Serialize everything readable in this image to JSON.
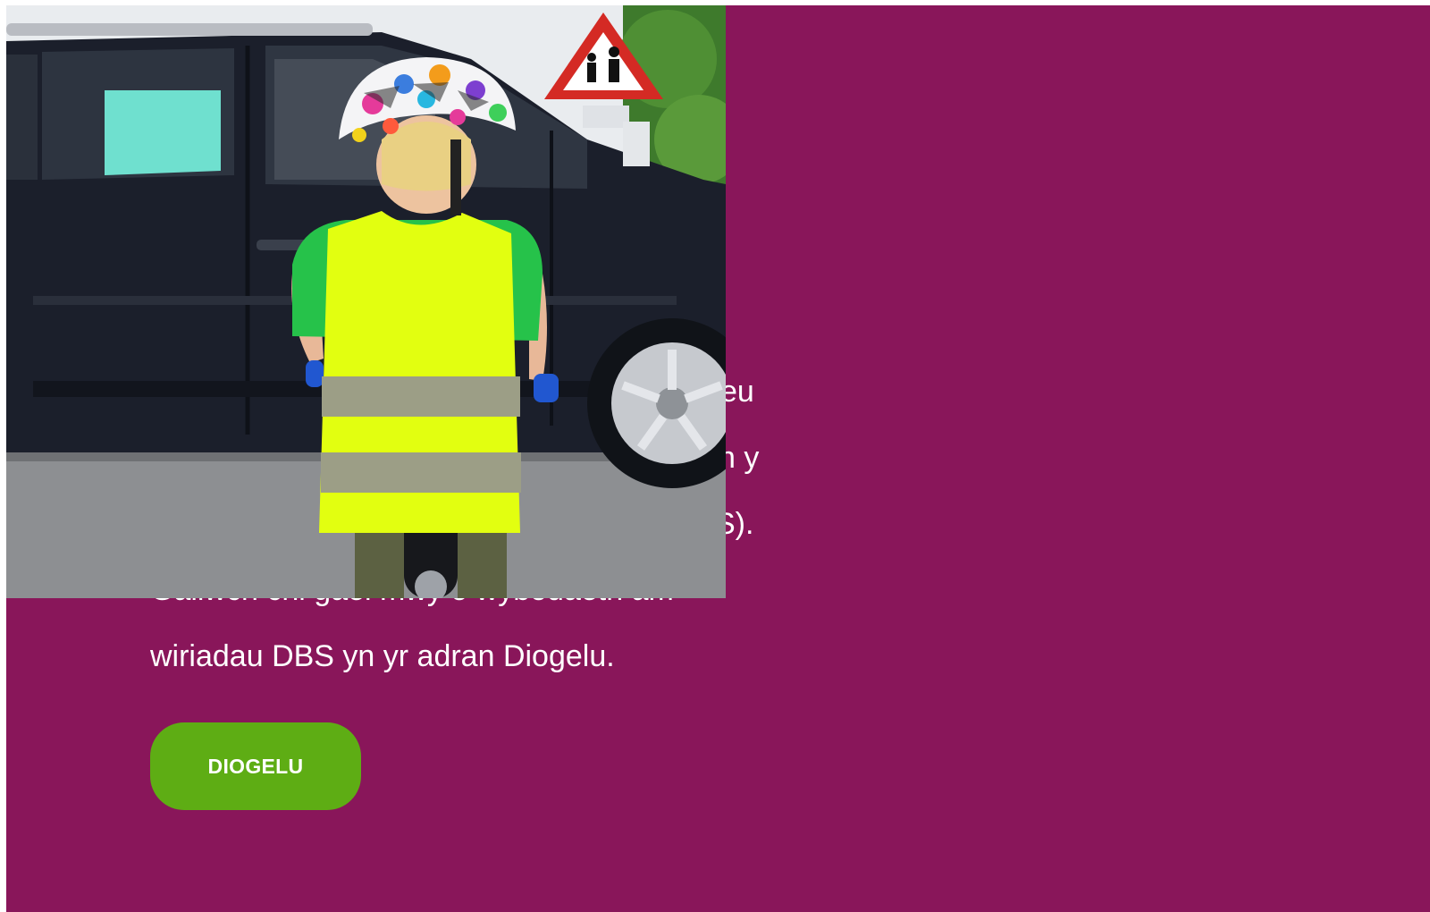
{
  "content": {
    "paragraph_lines": [
      "eu",
      "n y",
      "S).",
      "Gallwch chi gael mwy o wybodaeth am",
      "wiriadau DBS yn yr adran Diogelu."
    ],
    "button_label": "DIOGELU"
  },
  "photo": {
    "subject": "child in hi-vis vest on a balance bike next to a car, children crossing warning sign"
  },
  "colors": {
    "background": "#89165a",
    "button": "#5ead14",
    "text": "#ffffff"
  }
}
